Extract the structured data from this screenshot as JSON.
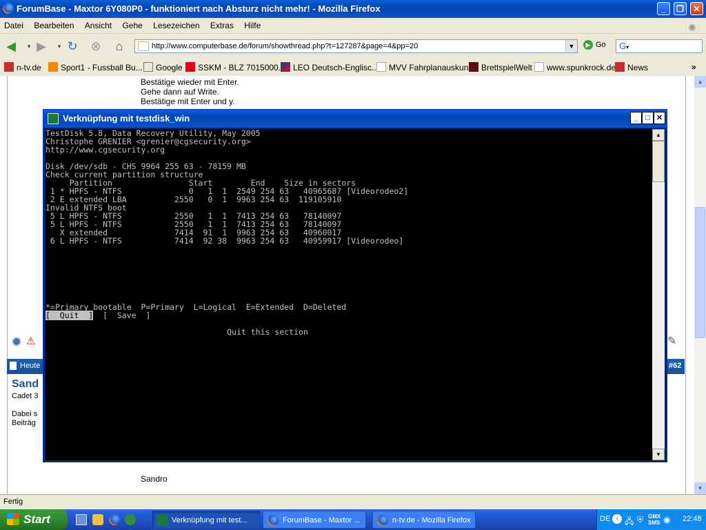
{
  "browser": {
    "title": "ForumBase - Maxtor 6Y080P0 - funktioniert nach Absturz nicht mehr! - Mozilla Firefox",
    "menu": [
      "Datei",
      "Bearbeiten",
      "Ansicht",
      "Gehe",
      "Lesezeichen",
      "Extras",
      "Hilfe"
    ],
    "url": "http://www.computerbase.de/forum/showthread.php?t=127287&page=4&pp=20",
    "go_label": "Go",
    "search_value": "G",
    "bookmarks": [
      "n-tv.de",
      "Sport1 - Fussball Bu...",
      "Google",
      "SSKM - BLZ 7015000...",
      "LEO Deutsch-Englisc...",
      "MVV Fahrplanauskunft",
      "BrettspielWelt",
      "www.spunkrock.de",
      "News"
    ],
    "status": "Fertig"
  },
  "page": {
    "lines": [
      "Bestätige wieder mit Enter.",
      "Gehe dann auf Write.",
      "Bestätige mit Enter und y."
    ],
    "post_header_left": "Heute",
    "post_number": "#62",
    "user_name": "Sand",
    "user_rank": "Cadet 3",
    "user_info_1": "Dabei s",
    "user_info_2": "Beiträg",
    "signature": "Sandro"
  },
  "console_window": {
    "title": "Verknüpfung mit testdisk_win",
    "lines": [
      "TestDisk 5.8, Data Recovery Utility, May 2005",
      "Christophe GRENIER <grenier@cgsecurity.org>",
      "http://www.cgsecurity.org",
      "",
      "Disk /dev/sdb - CHS 9964 255 63 - 78159 MB",
      "Check current partition structure",
      "     Partition                Start        End    Size in sectors",
      " 1 * HPFS - NTFS              0   1  1  2549 254 63   40965687 [Videorodeo2]",
      " 2 E extended LBA          2550   0  1  9963 254 63  119105910",
      "Invalid NTFS boot",
      " 5 L HPFS - NTFS           2550   1  1  7413 254 63   78140097",
      " 5 L HPFS - NTFS           2550   1  1  7413 254 63   78140097",
      "   X extended              7414  91  1  9963 254 63   40960017",
      " 6 L HPFS - NTFS           7414  92 38  9963 254 63   40959917 [Videorodeo]",
      "",
      "",
      "",
      "",
      "",
      "",
      "",
      "*=Primary bootable  P=Primary  L=Logical  E=Extended  D=Deleted"
    ],
    "quit_label": "[  Quit  ]",
    "save_label": "[  Save  ]",
    "hint": "Quit this section"
  },
  "taskbar": {
    "start_label": "Start",
    "buttons": [
      "Verknüpfung mit test...",
      "ForumBase - Maxtor ...",
      "n-tv.de - Mozilla Firefox"
    ],
    "lang": "DE",
    "clock": "22:48"
  }
}
